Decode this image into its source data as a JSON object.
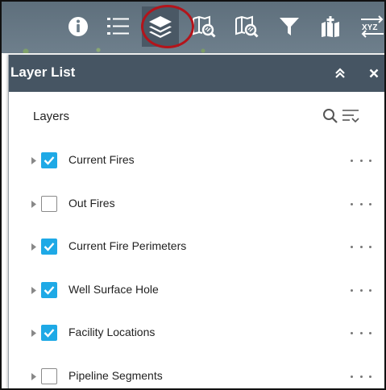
{
  "toolbar": {
    "tools": [
      {
        "name": "about",
        "icon": "info-icon"
      },
      {
        "name": "legend",
        "icon": "list-icon"
      },
      {
        "name": "layer-list",
        "icon": "layers-icon",
        "active": true
      },
      {
        "name": "query",
        "icon": "map-search-icon"
      },
      {
        "name": "screening",
        "icon": "map-search-icon"
      },
      {
        "name": "filter",
        "icon": "filter-icon"
      },
      {
        "name": "add-data",
        "icon": "add-data-icon"
      },
      {
        "name": "coordinate-conversion",
        "icon": "xyz-icon",
        "label": "XYZ"
      }
    ],
    "colors": {
      "bar": "#6b7d8a",
      "active": "#4a5865",
      "highlight": "#b3141b"
    }
  },
  "panel": {
    "title": "Layer List",
    "header_color": "#465563",
    "section_title": "Layers",
    "layers": [
      {
        "label": "Current Fires",
        "checked": true
      },
      {
        "label": "Out Fires",
        "checked": false
      },
      {
        "label": "Current Fire Perimeters",
        "checked": true
      },
      {
        "label": "Well Surface Hole",
        "checked": true
      },
      {
        "label": "Facility Locations",
        "checked": true
      },
      {
        "label": "Pipeline Segments",
        "checked": false
      }
    ],
    "check_color": "#1ea9e6"
  }
}
